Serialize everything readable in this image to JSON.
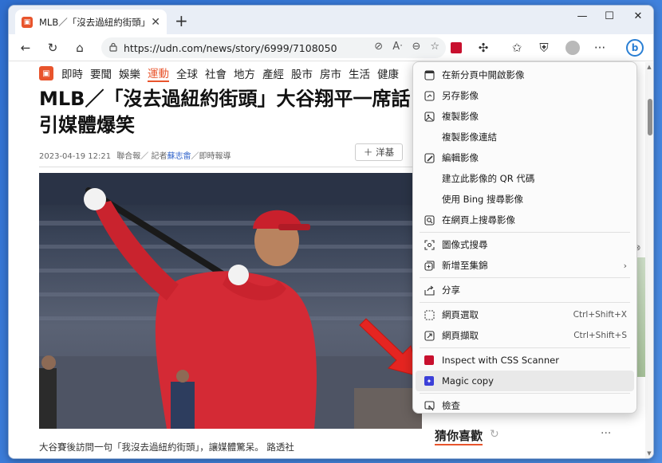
{
  "tab": {
    "title": "MLB／「沒去過紐約街頭」大谷翔",
    "close": "✕"
  },
  "newtab": "+",
  "window_controls": {
    "minimize": "—",
    "maximize": "☐",
    "close": "✕"
  },
  "address": {
    "url": "https://udn.com/news/story/6999/7108050"
  },
  "nav": {
    "items": [
      "即時",
      "要聞",
      "娛樂",
      "運動",
      "全球",
      "社會",
      "地方",
      "產經",
      "股市",
      "房市",
      "生活",
      "健康"
    ],
    "active_index": 3
  },
  "article": {
    "headline": "MLB／「沒去過紐約街頭」大谷翔平一席話引媒體爆笑",
    "date": "2023-04-19 12:21",
    "source": "聯合報／ 記者",
    "author": "蘇志畬",
    "author_suffix": "／即時報導",
    "follow": "＋ 洋基",
    "caption": "大谷賽後訪問一句「我沒去過紐約街頭」，讓媒體驚呆。 路透社"
  },
  "sidebar": {
    "guess_title": "猜你喜歡",
    "more": "···"
  },
  "context_menu": {
    "items": [
      {
        "label": "在新分頁中開啟影像",
        "icon": "new-tab-icon"
      },
      {
        "label": "另存影像",
        "icon": "save-icon"
      },
      {
        "label": "複製影像",
        "icon": "copy-image-icon"
      },
      {
        "label": "複製影像連結",
        "icon": ""
      },
      {
        "label": "編輯影像",
        "icon": "edit-image-icon"
      },
      {
        "label": "建立此影像的 QR 代碼",
        "icon": ""
      },
      {
        "label": "使用 Bing 搜尋影像",
        "icon": ""
      },
      {
        "label": "在網頁上搜尋影像",
        "icon": "search-image-icon"
      },
      {
        "label": "圖像式搜尋",
        "icon": "visual-search-icon"
      },
      {
        "label": "新增至集錦",
        "icon": "collections-icon",
        "submenu": true
      },
      {
        "label": "分享",
        "icon": "share-icon"
      },
      {
        "label": "網頁選取",
        "icon": "web-select-icon",
        "shortcut": "Ctrl+Shift+X"
      },
      {
        "label": "網頁擷取",
        "icon": "web-capture-icon",
        "shortcut": "Ctrl+Shift+S"
      },
      {
        "label": "Inspect with CSS Scanner",
        "icon": "css-scanner-icon"
      },
      {
        "label": "Magic copy",
        "icon": "magic-copy-icon",
        "highlighted": true
      },
      {
        "label": "檢查",
        "icon": "inspect-icon"
      }
    ]
  },
  "colors": {
    "brand": "#e8542c",
    "arrow": "#e52521",
    "link": "#3366cc"
  }
}
